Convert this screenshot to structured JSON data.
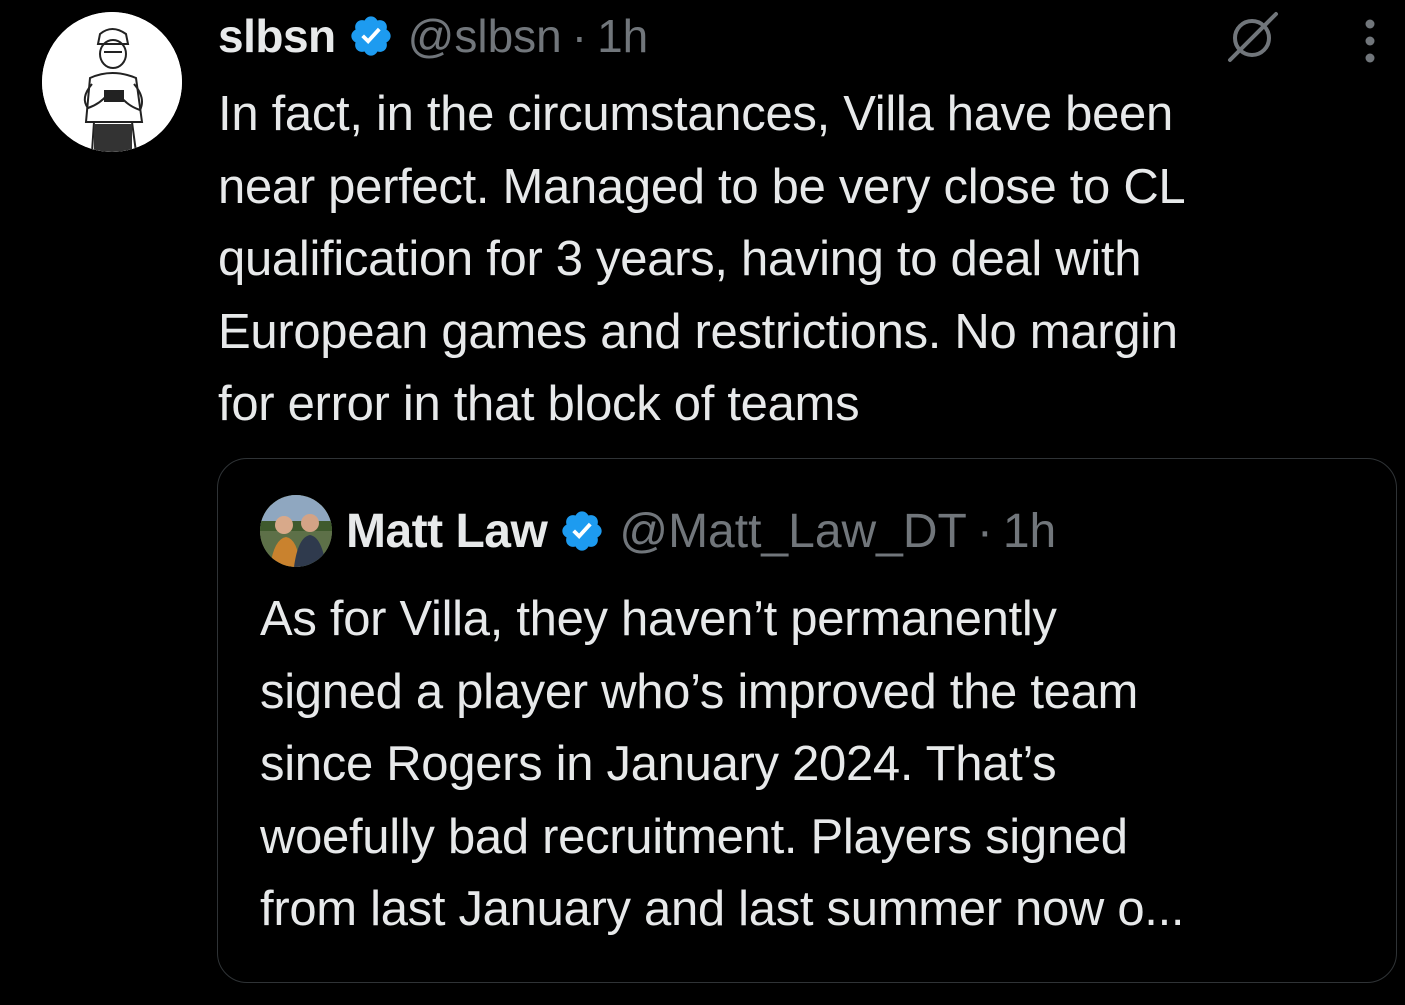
{
  "tweet": {
    "author": {
      "display_name": "slbsn",
      "handle": "@slbsn",
      "avatar_icon": "avatar-sketch-person",
      "verified_icon": "verified-badge-icon"
    },
    "separator": "·",
    "time": "1h",
    "actions": {
      "grok_icon": "grok-icon",
      "more_icon": "more-options-icon"
    },
    "text": "In fact, in the circumstances, Villa have been\nnear perfect. Managed to be very close to CL\nqualification for 3 years, having to deal with\nEuropean games and restrictions. No margin\nfor error in that block of teams"
  },
  "quoted_tweet": {
    "author": {
      "display_name": "Matt Law",
      "handle": "@Matt_Law_DT",
      "avatar_icon": "avatar-photo",
      "verified_icon": "verified-badge-icon"
    },
    "separator": "·",
    "time": "1h",
    "text": "As for Villa, they haven’t permanently\nsigned a player who’s improved the team\nsince Rogers in January 2024. That’s\nwoefully bad recruitment. Players signed\nfrom last January and last summer now o..."
  },
  "colors": {
    "background": "#000000",
    "primary_text": "#e7e9ea",
    "secondary_text": "#71767b",
    "verified_blue": "#1d9bf0",
    "card_border": "#2f3336"
  }
}
